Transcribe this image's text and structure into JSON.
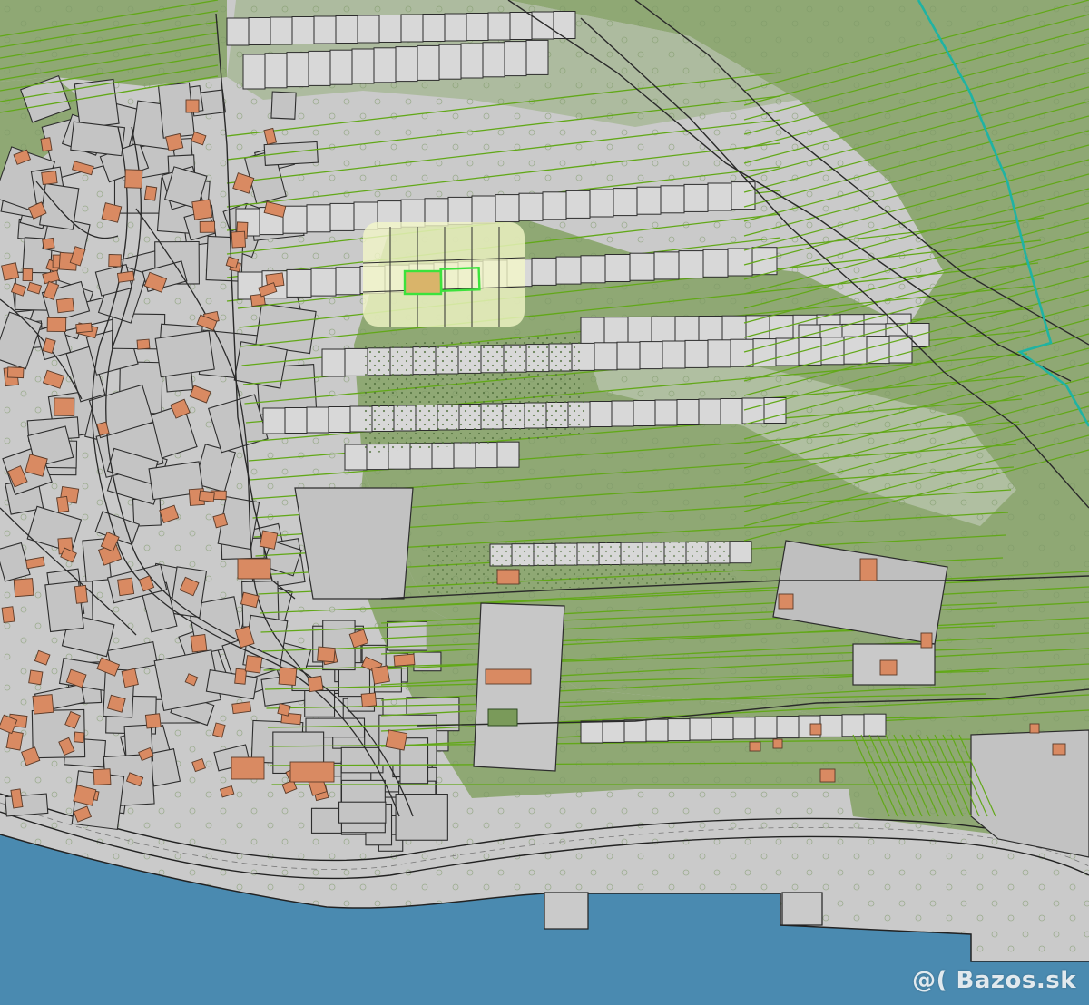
{
  "map": {
    "kind": "cadastral-parcel-map",
    "watermark": "@( Bazos.sk",
    "colors": {
      "sea": "#4a8ab0",
      "ground": "#cacaca",
      "vegetation": "#8fa874",
      "vegetation_dark": "#6f8f55",
      "parcel_line_green": "#62a818",
      "parcel_line_dark": "#333333",
      "building": "#d98a62",
      "building_outline": "#5a3a28",
      "boundary_teal": "#1fb3a3",
      "highlight": "#f4f7c8",
      "selected_outline": "#3ce23c"
    },
    "legend_features": [
      "sea",
      "coastal-road",
      "village-buildings",
      "cultivated-terraces",
      "selected-parcels",
      "municipal-boundary"
    ]
  }
}
